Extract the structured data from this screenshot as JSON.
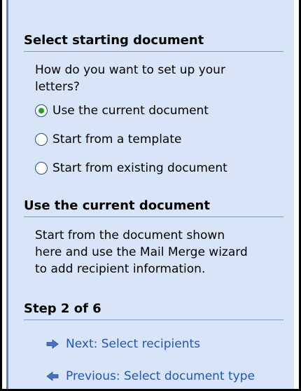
{
  "colors": {
    "pane_background": "#d8e4f8",
    "rule": "#7b9ad6",
    "link": "#2257b8",
    "radio_selected_dot": "#2a9a2a",
    "arrow": "#4a6fc2"
  },
  "select_starting_document": {
    "title": "Select starting document",
    "question_line1": "How do you want to set up your",
    "question_line2": "letters?",
    "options": [
      {
        "label": "Use the current document",
        "selected": true
      },
      {
        "label": "Start from a template",
        "selected": false
      },
      {
        "label": "Start from existing document",
        "selected": false
      }
    ]
  },
  "use_current_document": {
    "title": "Use the current document",
    "description_line1": "Start from the document shown",
    "description_line2": "here and use the Mail Merge wizard",
    "description_line3": "to add recipient information."
  },
  "step": {
    "title": "Step 2 of 6",
    "next": {
      "label": "Next: Select recipients",
      "icon": "arrow-right-icon"
    },
    "previous": {
      "label": "Previous: Select document type",
      "icon": "arrow-left-icon"
    }
  }
}
